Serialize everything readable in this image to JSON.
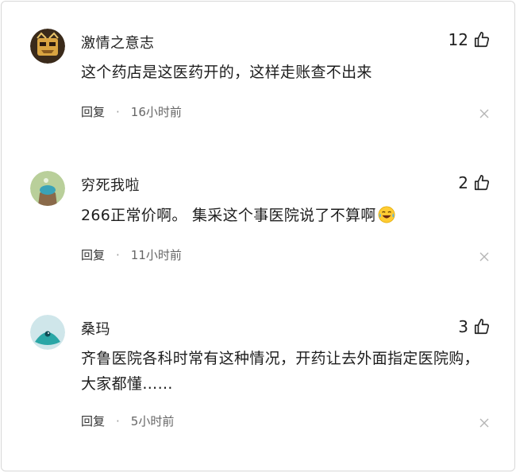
{
  "comments": [
    {
      "username": "激情之意志",
      "likes": "12",
      "text": "这个药店是这医药开的，这样走账查不出来",
      "reply_label": "回复",
      "separator": "·",
      "time": "16小时前"
    },
    {
      "username": "穷死我啦",
      "likes": "2",
      "text": "266正常价啊。 集采这个事医院说了不算啊",
      "reply_label": "回复",
      "separator": "·",
      "time": "11小时前"
    },
    {
      "username": "桑玛",
      "likes": "3",
      "text": "齐鲁医院各科时常有这种情况，开药让去外面指定医院购，大家都懂……",
      "reply_label": "回复",
      "separator": "·",
      "time": "5小时前"
    }
  ],
  "icons": {
    "like": "thumbs-up-icon",
    "close": "close-icon",
    "emoji": "crying-laughing-emoji"
  }
}
